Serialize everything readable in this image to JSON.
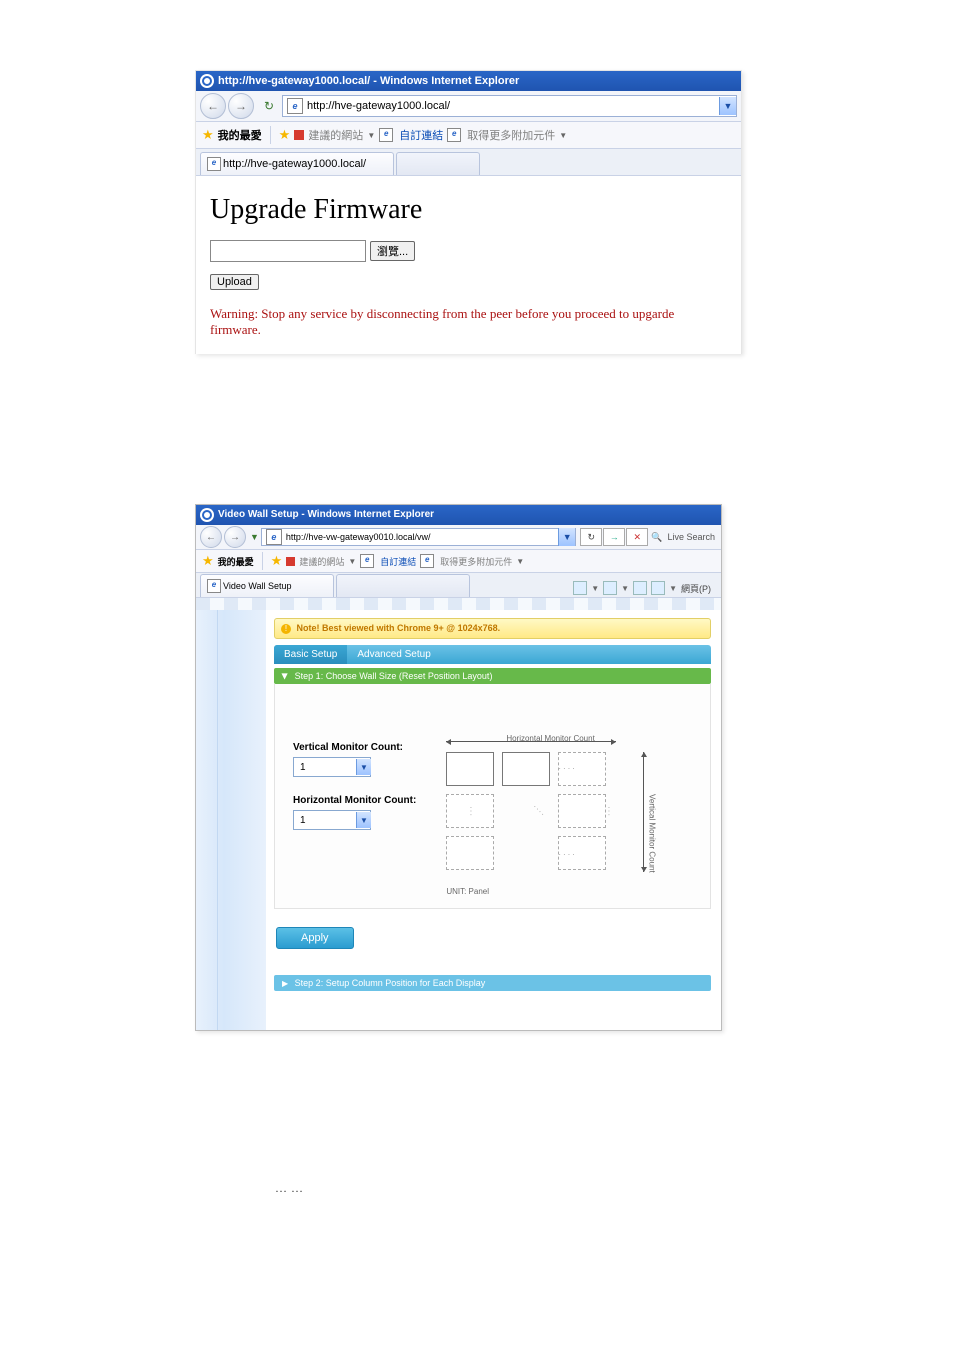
{
  "screenshot1": {
    "window_title": "http://hve-gateway1000.local/ - Windows Internet Explorer",
    "address_bar": "http://hve-gateway1000.local/",
    "favorites_label": "我的最愛",
    "fav_links": {
      "suggested": "建議的網站",
      "custom": "自訂連結",
      "more_addons": "取得更多附加元件"
    },
    "tab_title": "http://hve-gateway1000.local/",
    "page": {
      "heading": "Upgrade Firmware",
      "browse_button": "瀏覽...",
      "upload_button": "Upload",
      "warning": "Warning: Stop any service by disconnecting from the peer before you proceed to upgarde firmware."
    }
  },
  "screenshot2": {
    "window_title": "Video Wall Setup - Windows Internet Explorer",
    "address_bar": "http://hve-vw-gateway0010.local/vw/",
    "search_hint": "Live Search",
    "favorites_label": "我的最愛",
    "fav_links": {
      "suggested": "建議的網站",
      "custom": "自訂連結",
      "more_addons": "取得更多附加元件"
    },
    "tab_title": "Video Wall Setup",
    "toolbar_right": "網頁(P)",
    "note": "Note! Best viewed with Chrome 9+ @ 1024x768.",
    "tabs": {
      "basic": "Basic Setup",
      "advanced": "Advanced Setup"
    },
    "step1": {
      "title": "Step 1: Choose Wall Size (Reset Position Layout)",
      "vertical_label": "Vertical Monitor Count:",
      "vertical_value": "1",
      "horizontal_label": "Horizontal Monitor Count:",
      "horizontal_value": "1",
      "diagram_h_label": "Horizontal Monitor Count",
      "diagram_v_label": "Vertical Monitor Count",
      "unit_label": "UNIT: Panel",
      "apply": "Apply"
    },
    "step2_title": "Step 2: Setup Column Position for Each Display"
  },
  "ellipsis": "……"
}
